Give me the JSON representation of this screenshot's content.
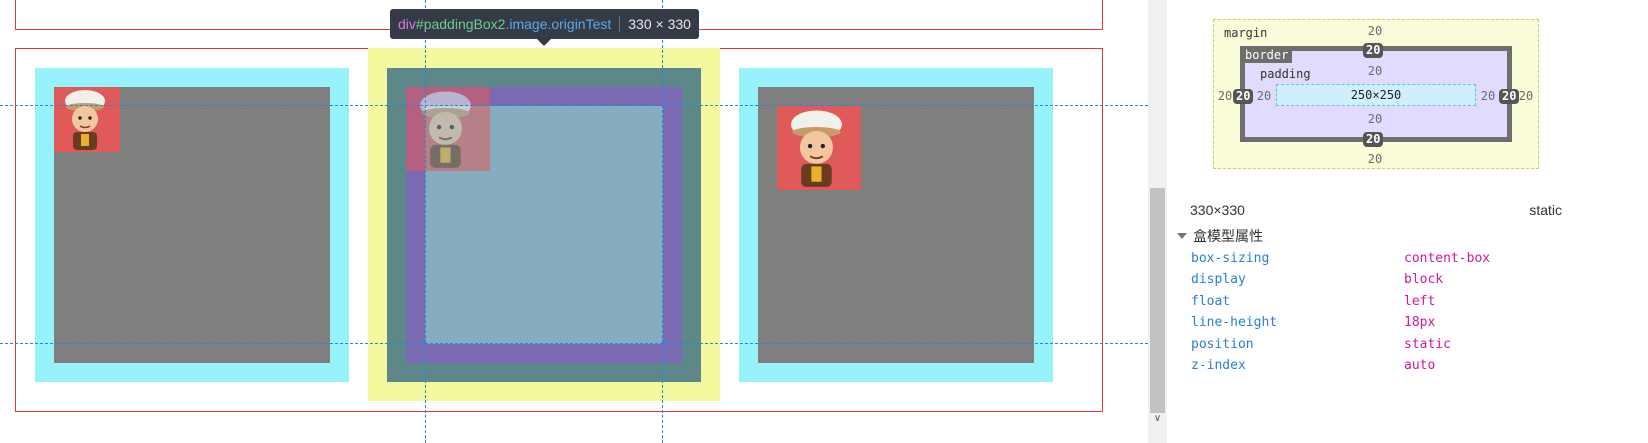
{
  "inspector_tooltip": {
    "tag": "div",
    "id": "#paddingBox2",
    "classes": ".image.originTest",
    "size": "330 × 330"
  },
  "box_model": {
    "margin_label": "margin",
    "border_label": "border",
    "padding_label": "padding",
    "content_size": "250×250",
    "margin": {
      "top": "20",
      "right": "20",
      "bottom": "20",
      "left": "20"
    },
    "border": {
      "top": "20",
      "right": "20",
      "bottom": "20",
      "left": "20"
    },
    "padding": {
      "top": "20",
      "right": "20",
      "bottom": "20",
      "left": "20"
    }
  },
  "computed": {
    "dimensions": "330×330",
    "position_summary": "static",
    "section_title": "盒模型属性",
    "properties": [
      {
        "name": "box-sizing",
        "value": "content-box"
      },
      {
        "name": "display",
        "value": "block"
      },
      {
        "name": "float",
        "value": "left"
      },
      {
        "name": "line-height",
        "value": "18px"
      },
      {
        "name": "position",
        "value": "static"
      },
      {
        "name": "z-index",
        "value": "auto"
      }
    ]
  },
  "colors": {
    "margin_highlight": "#f3f99e",
    "border_highlight": "#5e878a",
    "padding_highlight": "#7b69b3",
    "content_highlight": "#85adbf",
    "box_padding": "#98f2fb",
    "box_content": "#7f7f7f",
    "container_outline": "#e53935",
    "guide_line": "#1a8cd8",
    "property_name": "#2a7fd4",
    "property_value": "#d3169d"
  }
}
